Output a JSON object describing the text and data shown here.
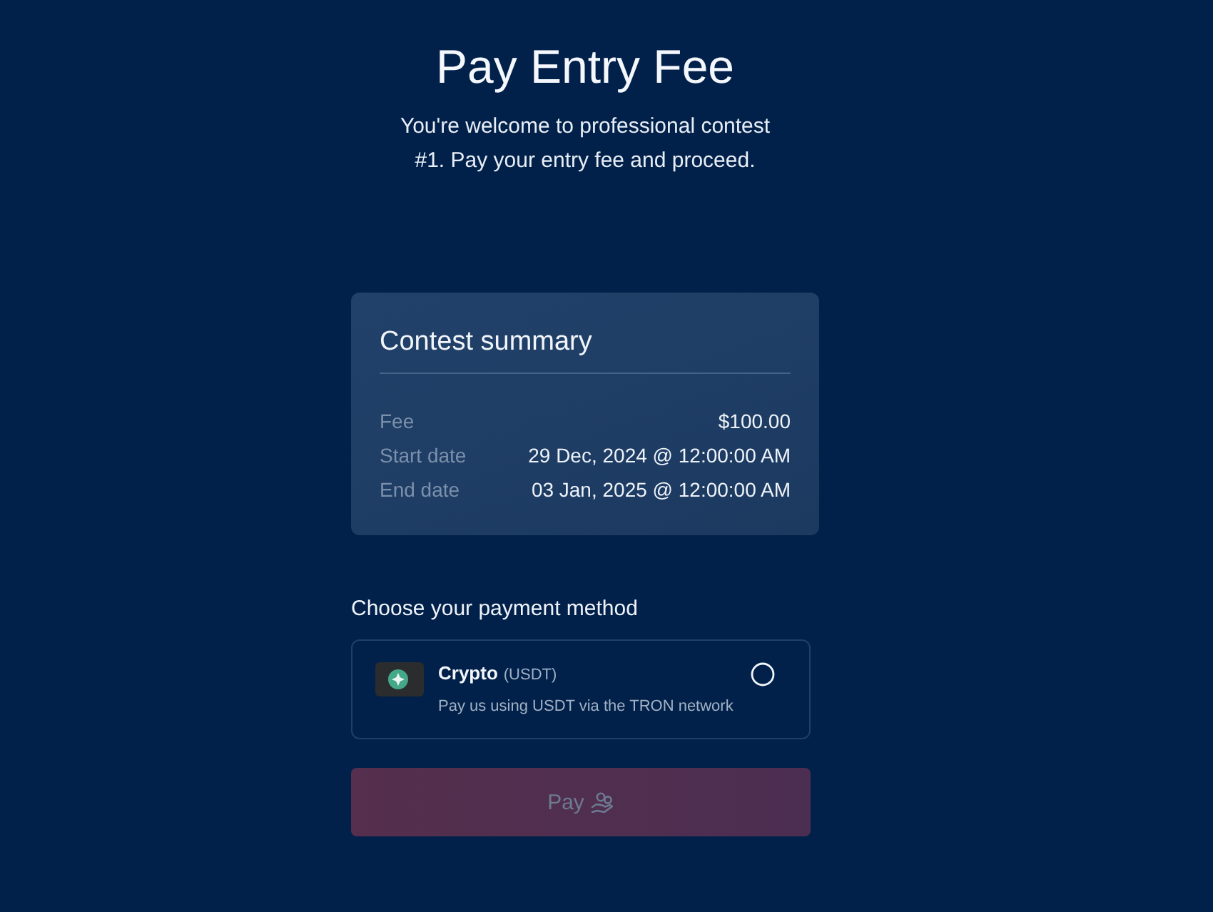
{
  "header": {
    "title": "Pay Entry Fee",
    "subtitle": "You're welcome to professional contest #1. Pay your entry fee and proceed."
  },
  "summary": {
    "title": "Contest summary",
    "rows": [
      {
        "label": "Fee",
        "value": "$100.00"
      },
      {
        "label": "Start date",
        "value": "29 Dec, 2024 @ 12:00:00 AM"
      },
      {
        "label": "End date",
        "value": "03 Jan, 2025 @ 12:00:00 AM"
      }
    ]
  },
  "payment": {
    "heading": "Choose your payment method",
    "methods": [
      {
        "name": "Crypto",
        "note": "(USDT)",
        "description": "Pay us using USDT via the TRON network",
        "selected": false
      }
    ]
  },
  "pay_button": {
    "label": "Pay",
    "disabled": true
  }
}
